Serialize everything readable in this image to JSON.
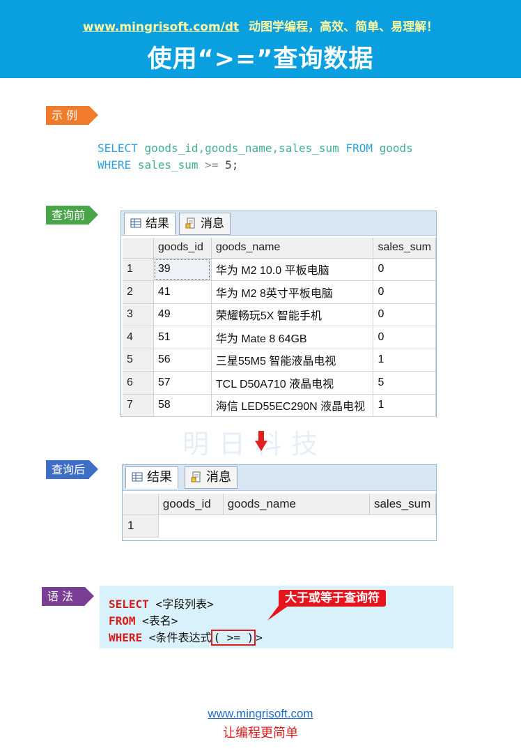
{
  "header": {
    "url": "www.mingrisoft.com/dt",
    "slogan": "动图学编程，高效、简单、易理解！",
    "title": "使用“>=”查询数据"
  },
  "labels": {
    "example": "示 例",
    "before": "查询前",
    "after": "查询后",
    "syntax": "语 法"
  },
  "example_sql": {
    "select_kw": "SELECT",
    "columns": "goods_id,goods_name,sales_sum",
    "from_kw": "FROM",
    "table": "goods",
    "where_kw": "WHERE",
    "cond_col": "sales_sum",
    "operator": ">=",
    "value": "5",
    "semicolon": ";"
  },
  "tabs": {
    "results": "结果",
    "messages": "消息"
  },
  "before_grid": {
    "columns": [
      "goods_id",
      "goods_name",
      "sales_sum"
    ],
    "rows": [
      {
        "n": "1",
        "goods_id": "39",
        "goods_name": "华为 M2 10.0 平板电脑",
        "sales_sum": "0"
      },
      {
        "n": "2",
        "goods_id": "41",
        "goods_name": "华为 M2 8英寸平板电脑",
        "sales_sum": "0"
      },
      {
        "n": "3",
        "goods_id": "49",
        "goods_name": "荣耀畅玩5X 智能手机",
        "sales_sum": "0"
      },
      {
        "n": "4",
        "goods_id": "51",
        "goods_name": "华为 Mate 8 64GB",
        "sales_sum": "0"
      },
      {
        "n": "5",
        "goods_id": "56",
        "goods_name": "三星55M5 智能液晶电视",
        "sales_sum": "1"
      },
      {
        "n": "6",
        "goods_id": "57",
        "goods_name": "TCL D50A710 液晶电视",
        "sales_sum": "5"
      },
      {
        "n": "7",
        "goods_id": "58",
        "goods_name": "海信 LED55EC290N 液晶电视",
        "sales_sum": "1"
      }
    ]
  },
  "after_grid": {
    "columns": [
      "goods_id",
      "goods_name",
      "sales_sum"
    ],
    "row_number": "1"
  },
  "watermark": "明日科技",
  "syntax": {
    "line1_kw": "SELECT",
    "line1_rest": " <字段列表>",
    "line2_kw": "FROM",
    "line2_rest": " <表名>",
    "line3_kw": "WHERE",
    "line3_pre": " <条件表达式",
    "line3_op": "( >= )",
    "line3_post": ">",
    "callout": "大于或等于查询符"
  },
  "footer": {
    "url": "www.mingrisoft.com",
    "slogan": "让编程更简单"
  },
  "colors": {
    "banner": "#0aa0e0",
    "keyword": "#d81b1b",
    "accent": "#e8141c"
  }
}
